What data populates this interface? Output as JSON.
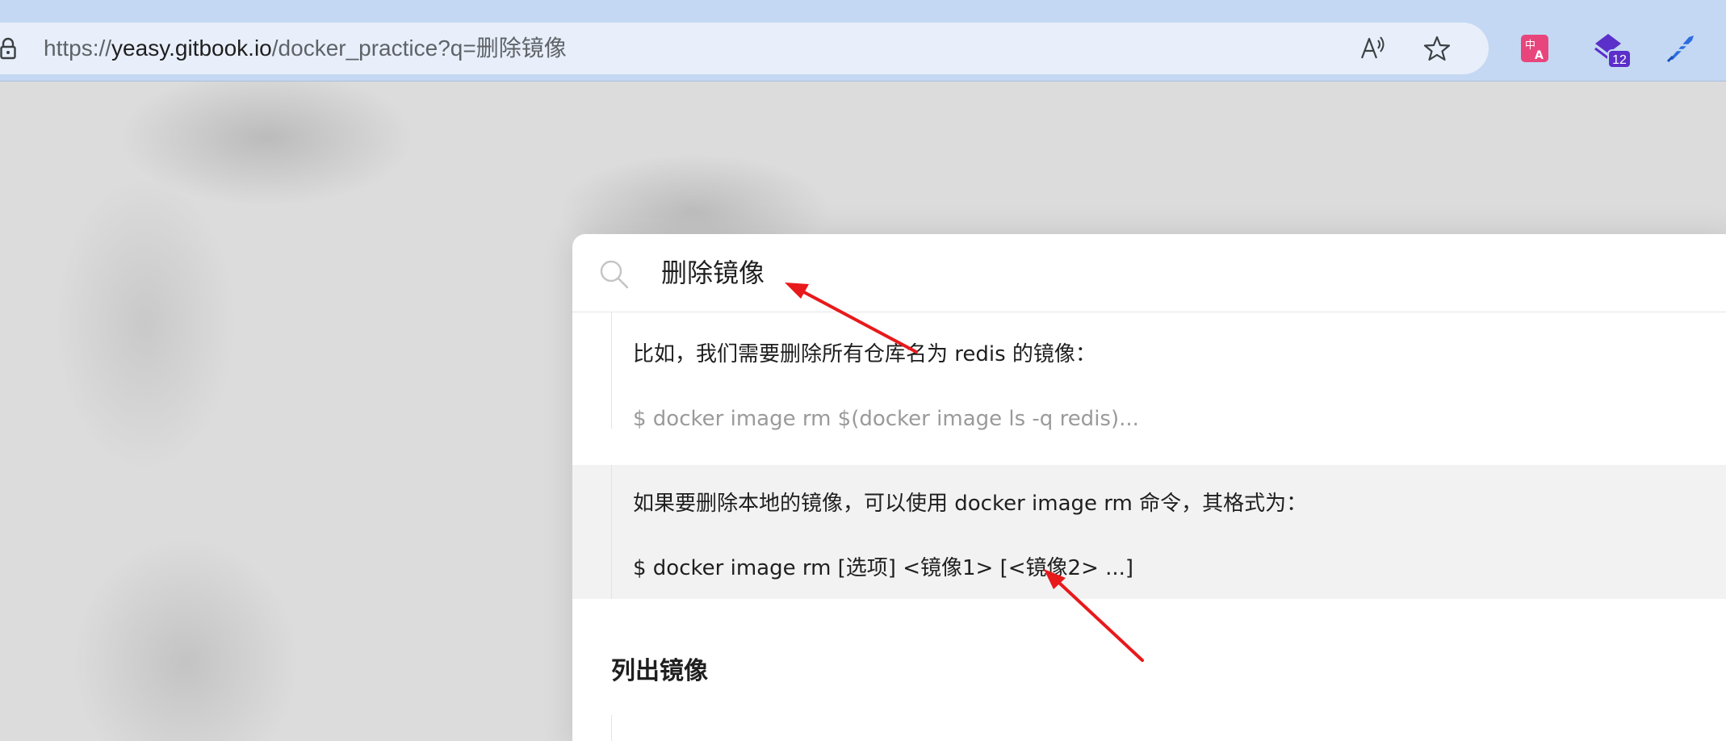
{
  "browser": {
    "address_bar": {
      "url_scheme": "https://",
      "url_host": "yeasy.gitbook.io",
      "url_path": "/docker_practice?q=删除镜像"
    },
    "icons": {
      "lock": "lock-icon",
      "read_aloud": "read-aloud-icon",
      "favorite": "star-icon",
      "extensions": [
        "translate-ext-icon",
        "stack-ext-icon",
        "pen-ext-icon"
      ]
    },
    "extension_badge": "12"
  },
  "search": {
    "query": "删除镜像",
    "results": [
      {
        "title": "比如，我们需要删除所有仓库名为 redis 的镜像：",
        "snippet": "$ docker image rm $(docker image ls -q redis)..."
      },
      {
        "title": "如果要删除本地的镜像，可以使用 docker image rm 命令，其格式为：",
        "snippet": "$ docker image rm [选项] <镜像1> [<镜像2> ...]"
      }
    ],
    "section_heading": "列出镜像"
  },
  "colors": {
    "browser_chrome": "#c4d8f3",
    "address_bar": "#e8effa",
    "highlight_row": "#f2f2f2",
    "annotation_arrow": "#e8191b",
    "badge": "#5b2fc9"
  }
}
